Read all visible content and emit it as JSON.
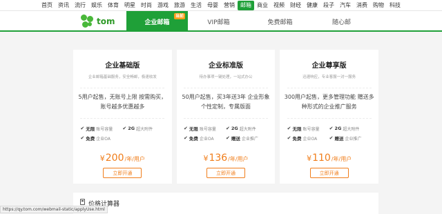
{
  "topnav": [
    "首页",
    "资讯",
    "流行",
    "娱乐",
    "体育",
    "明星",
    "时尚",
    "游戏",
    "旅游",
    "生活",
    "母婴",
    "营销",
    "邮箱",
    "商业",
    "视频",
    "财经",
    "健康",
    "段子",
    "汽车",
    "消费",
    "购物",
    "科技"
  ],
  "topnav_active_index": 12,
  "logo": {
    "word": "tom"
  },
  "tabs": [
    {
      "label": "企业邮箱",
      "badge": "当前"
    },
    {
      "label": "VIP邮箱"
    },
    {
      "label": "免费邮箱"
    },
    {
      "label": "随心邮"
    }
  ],
  "plans": [
    {
      "title": "企业基础版",
      "subtitle": "企业邮箱基础服务，安全畅邮，极速收发",
      "desc": "5用户起售，无账号上限 按需购买，账号越多优惠越多",
      "features": [
        [
          "无限",
          "账号容量"
        ],
        [
          "2G",
          "超大附件"
        ],
        [
          "免费",
          "企业OA"
        ]
      ],
      "currency": "¥",
      "price": "200",
      "unit": "/年/用户",
      "button": "立即开通"
    },
    {
      "title": "企业标准版",
      "subtitle": "待办事项一键处理，一站式办公",
      "desc": "50用户起售，买3年送3年 企业形象个性定制，专属版面",
      "features": [
        [
          "无限",
          "账号容量"
        ],
        [
          "2G",
          "超大附件"
        ],
        [
          "免费",
          "企业OA"
        ],
        [
          "赠送",
          "企业推广"
        ]
      ],
      "currency": "¥",
      "price": "136",
      "unit": "/年/用户",
      "button": "立即开通"
    },
    {
      "title": "企业尊享版",
      "subtitle": "迅速响应，专业客服一对一服务",
      "desc": "300用户起售，更多管理功能 赠送多种形式的企业推广服务",
      "features": [
        [
          "无限",
          "账号容量"
        ],
        [
          "2G",
          "超大附件"
        ],
        [
          "免费",
          "企业OA"
        ],
        [
          "赠送",
          "企业推广"
        ]
      ],
      "currency": "¥",
      "price": "110",
      "unit": "/年/用户",
      "button": "立即开通"
    }
  ],
  "calc": {
    "title": "价格计算器",
    "icon": "calculator-icon"
  },
  "status_url": "https://qy.tom.com/webmail-static/applyUse.html",
  "colors": {
    "accent": "#1fa038",
    "price": "#f07d1a",
    "badge": "#ff9e1b"
  }
}
